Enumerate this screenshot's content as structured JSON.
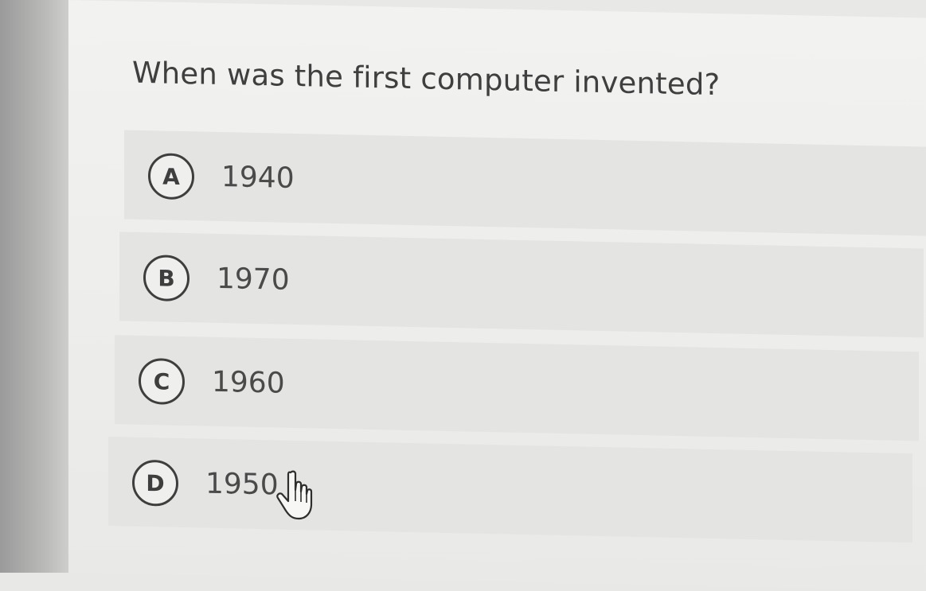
{
  "quiz": {
    "question": "When was the first computer invented?",
    "options": [
      {
        "letter": "A",
        "text": "1940"
      },
      {
        "letter": "B",
        "text": "1970"
      },
      {
        "letter": "C",
        "text": "1960"
      },
      {
        "letter": "D",
        "text": "1950"
      }
    ]
  },
  "icons": {
    "cursor": "hand-pointer-icon"
  }
}
